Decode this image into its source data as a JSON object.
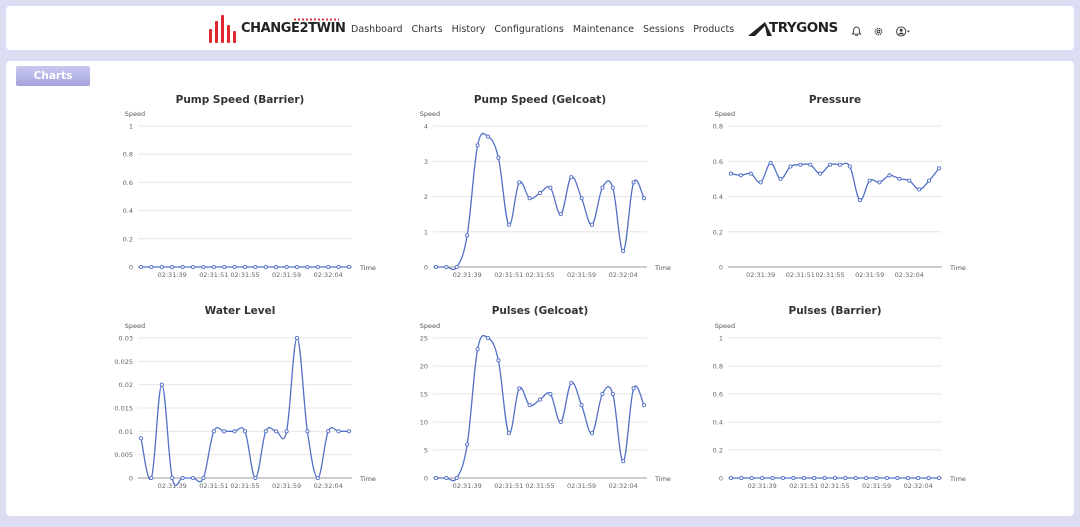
{
  "nav": {
    "brand": "CHANGE2TWIN",
    "items": [
      "Dashboard",
      "Charts",
      "History",
      "Configurations",
      "Maintenance",
      "Sessions",
      "Products"
    ],
    "partner_brand": "TRYGONS",
    "icons": [
      "bell-icon",
      "gear-icon",
      "user-circle-icon",
      "caret-down-icon"
    ]
  },
  "colors": {
    "brand_red": "#e0262e",
    "series": "#5470c6",
    "grid": "#e6e6e6",
    "page_bg": "#dcdcf2",
    "tab_accent": "#a4a4dd"
  },
  "panel": {
    "tab_label": "Charts"
  },
  "chart_data": [
    {
      "type": "line",
      "title": "Pump Speed (Barrier)",
      "ylabel": "Speed",
      "xlabel": "Time",
      "ylim": [
        0,
        1
      ],
      "yticks": [
        "0",
        "0.2",
        "0.4",
        "0.6",
        "0.8",
        "1"
      ],
      "xticks": [
        "02:31:39",
        "02:31:51",
        "02:31:55",
        "02:31:59",
        "02:32:04"
      ],
      "xtick_index": [
        3,
        7,
        10,
        14,
        18
      ],
      "smooth": true,
      "series": [
        {
          "values": [
            0,
            0,
            0,
            0,
            0,
            0,
            0,
            0,
            0,
            0,
            0,
            0,
            0,
            0,
            0,
            0,
            0,
            0,
            0,
            0,
            0
          ]
        }
      ]
    },
    {
      "type": "line",
      "title": "Pump Speed (Gelcoat)",
      "ylabel": "Speed",
      "xlabel": "Time",
      "ylim": [
        0,
        4
      ],
      "yticks": [
        "0",
        "1",
        "2",
        "3",
        "4"
      ],
      "xticks": [
        "02:31:39",
        "02:31:51",
        "02:31:55",
        "02:31:59",
        "02:32:04"
      ],
      "xtick_index": [
        3,
        7,
        10,
        14,
        18
      ],
      "smooth": true,
      "series": [
        {
          "values": [
            0,
            0,
            0,
            0.9,
            3.45,
            3.7,
            3.1,
            1.2,
            2.4,
            1.95,
            2.1,
            2.25,
            1.5,
            2.55,
            1.95,
            1.2,
            2.25,
            2.25,
            0.45,
            2.4,
            1.95
          ]
        }
      ]
    },
    {
      "type": "line",
      "title": "Pressure",
      "ylabel": "Speed",
      "xlabel": "Time",
      "ylim": [
        0,
        0.8
      ],
      "yticks": [
        "0",
        "0.2",
        "0.4",
        "0.6",
        "0.8"
      ],
      "xticks": [
        "02:31:39",
        "02:31:51",
        "02:31:55",
        "02:31:59",
        "02:32:04"
      ],
      "xtick_index": [
        3,
        7,
        10,
        14,
        18
      ],
      "smooth": true,
      "series": [
        {
          "values": [
            0.53,
            0.52,
            0.53,
            0.48,
            0.59,
            0.5,
            0.57,
            0.58,
            0.58,
            0.53,
            0.58,
            0.58,
            0.57,
            0.38,
            0.49,
            0.48,
            0.52,
            0.5,
            0.49,
            0.44,
            0.49,
            0.56
          ]
        }
      ]
    },
    {
      "type": "line",
      "title": "Water Level",
      "ylabel": "Speed",
      "xlabel": "Time",
      "ylim": [
        0,
        0.03
      ],
      "yticks": [
        "0",
        "0.005",
        "0.01",
        "0.015",
        "0.02",
        "0.025",
        "0.03"
      ],
      "xticks": [
        "02:31:39",
        "02:31:51",
        "02:31:55",
        "02:31:59",
        "02:32:04"
      ],
      "xtick_index": [
        3,
        7,
        10,
        14,
        18
      ],
      "smooth": true,
      "series": [
        {
          "values": [
            0.0085,
            0,
            0.02,
            0,
            0,
            0,
            0,
            0.01,
            0.01,
            0.01,
            0.01,
            0,
            0.01,
            0.01,
            0.01,
            0.03,
            0.01,
            0,
            0.01,
            0.01,
            0.01
          ]
        }
      ]
    },
    {
      "type": "line",
      "title": "Pulses (Gelcoat)",
      "ylabel": "Speed",
      "xlabel": "Time",
      "ylim": [
        0,
        25
      ],
      "yticks": [
        "0",
        "5",
        "10",
        "15",
        "20",
        "25"
      ],
      "xticks": [
        "02:31:39",
        "02:31:51",
        "02:31:55",
        "02:31:59",
        "02:32:04"
      ],
      "xtick_index": [
        3,
        7,
        10,
        14,
        18
      ],
      "smooth": true,
      "series": [
        {
          "values": [
            0,
            0,
            0,
            6,
            23,
            25,
            21,
            8,
            16,
            13,
            14,
            15,
            10,
            17,
            13,
            8,
            15,
            15,
            3,
            16,
            13
          ]
        }
      ]
    },
    {
      "type": "line",
      "title": "Pulses (Barrier)",
      "ylabel": "Speed",
      "xlabel": "Time",
      "ylim": [
        0,
        1
      ],
      "yticks": [
        "0",
        "0.2",
        "0.4",
        "0.6",
        "0.8",
        "1"
      ],
      "xticks": [
        "02:31:39",
        "02:31:51",
        "02:31:55",
        "02:31:59",
        "02:32:04"
      ],
      "xtick_index": [
        3,
        7,
        10,
        14,
        18
      ],
      "smooth": true,
      "series": [
        {
          "values": [
            0,
            0,
            0,
            0,
            0,
            0,
            0,
            0,
            0,
            0,
            0,
            0,
            0,
            0,
            0,
            0,
            0,
            0,
            0,
            0,
            0
          ]
        }
      ]
    }
  ]
}
